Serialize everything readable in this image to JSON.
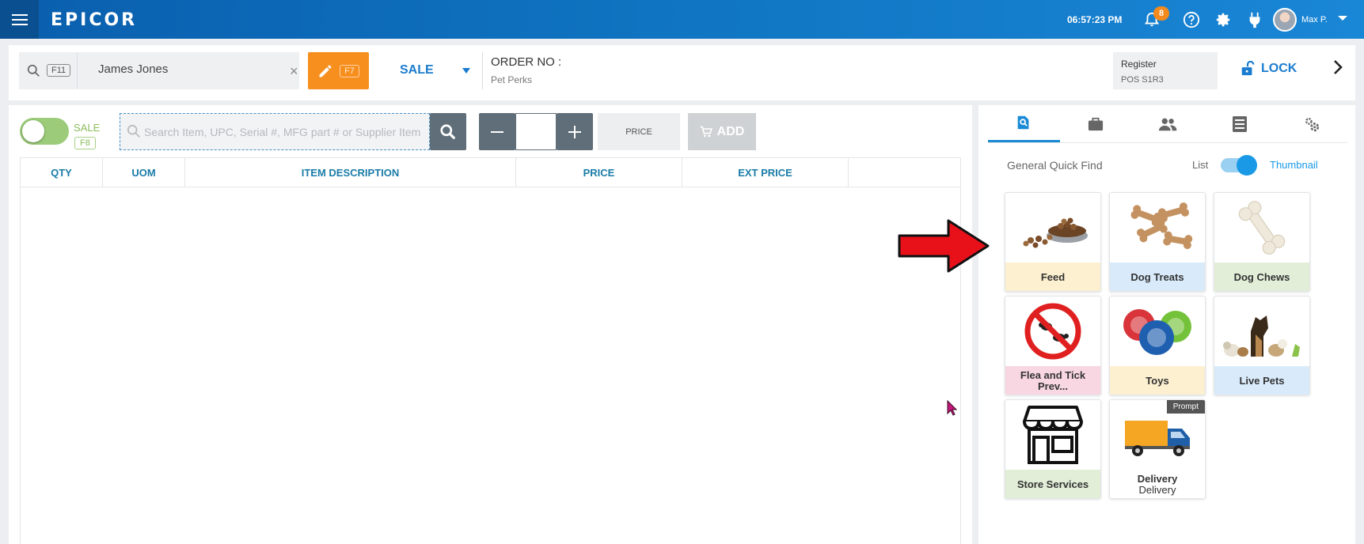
{
  "topbar": {
    "brand": "EPICOR",
    "clock": "06:57:23 PM",
    "notification_count": "8",
    "user_name": "Max P."
  },
  "subbar": {
    "customer_search_key": "F11",
    "customer_name": "James Jones",
    "edit_key": "F7",
    "sale_mode": "SALE",
    "order_label": "ORDER NO :",
    "store_name": "Pet Perks",
    "register_label": "Register",
    "register_value": "POS S1R3",
    "lock_label": "LOCK"
  },
  "item_entry": {
    "sale_toggle_label": "SALE",
    "sale_toggle_key": "F8",
    "search_placeholder": "Search Item, UPC, Serial #, MFG part # or Supplier Item",
    "qty_value": "",
    "price_label": "PRICE",
    "add_label": "ADD"
  },
  "grid": {
    "columns": [
      "QTY",
      "UOM",
      "ITEM DESCRIPTION",
      "PRICE",
      "EXT PRICE",
      ""
    ]
  },
  "quick_find": {
    "title": "General Quick Find",
    "list_label": "List",
    "thumbnail_label": "Thumbnail",
    "tiles": [
      {
        "label": "Feed",
        "sub": "",
        "color": "#fdf0d0",
        "icon": "pet-food-bowl-icon"
      },
      {
        "label": "Dog Treats",
        "sub": "",
        "color": "#d9ebfa",
        "icon": "dog-bone-treats-icon"
      },
      {
        "label": "Dog Chews",
        "sub": "",
        "color": "#e2eed8",
        "icon": "rawhide-chew-icon"
      },
      {
        "label": "Flea and Tick Prev...",
        "sub": "",
        "color": "#f8d7e2",
        "icon": "no-flea-icon"
      },
      {
        "label": "Toys",
        "sub": "",
        "color": "#fdf0d0",
        "icon": "ball-toys-icon"
      },
      {
        "label": "Live Pets",
        "sub": "",
        "color": "#d9ebfa",
        "icon": "pets-group-icon"
      },
      {
        "label": "Store Services",
        "sub": "",
        "color": "#e2eed8",
        "icon": "storefront-icon"
      },
      {
        "label": "Delivery",
        "sub": "Delivery",
        "color": "#ffffff",
        "icon": "delivery-truck-icon",
        "tag": "Prompt"
      }
    ]
  },
  "colors": {
    "accent": "#1a7ccf",
    "orange": "#f78f1e",
    "sale_green": "#8bbd5a"
  }
}
